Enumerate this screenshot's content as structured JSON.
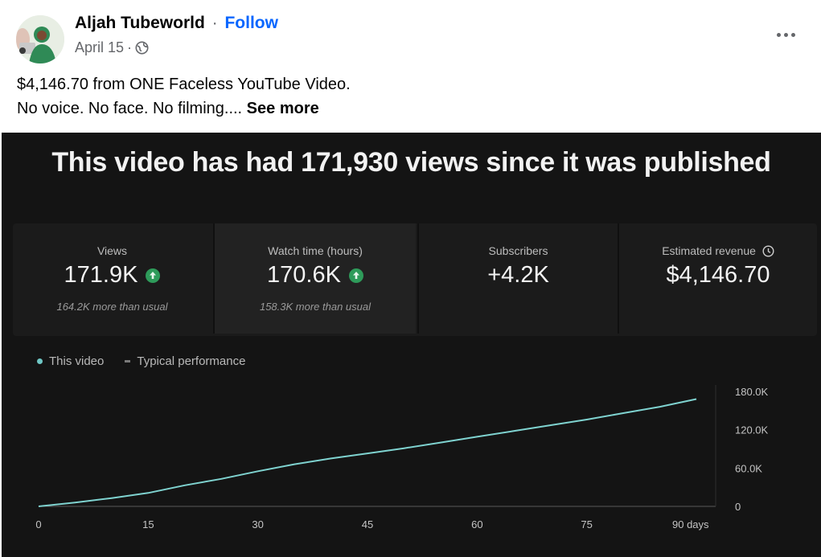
{
  "post": {
    "author": "Aljah Tubeworld",
    "separator": "·",
    "follow_label": "Follow",
    "date": "April 15",
    "date_separator": "·",
    "privacy_icon": "globe-icon",
    "more_icon": "more-horizontal-icon",
    "caption_line1": "$4,146.70 from ONE Faceless YouTube Video.",
    "caption_line2": "No voice. No face. No filming....",
    "see_more_label": "See more"
  },
  "image": {
    "headline": "This video has had 171,930 views since it was published",
    "stats": [
      {
        "label": "Views",
        "value": "171.9K",
        "up": true,
        "sub": "164.2K more than usual"
      },
      {
        "label": "Watch time (hours)",
        "value": "170.6K",
        "up": true,
        "sub": "158.3K more than usual"
      },
      {
        "label": "Subscribers",
        "value": "+4.2K",
        "up": false,
        "sub": ""
      },
      {
        "label": "Estimated revenue",
        "value": "$4,146.70",
        "up": false,
        "sub": ""
      }
    ],
    "legend": {
      "this_video": "This video",
      "typical": "Typical performance"
    },
    "colors": {
      "line": "#7fd3d0",
      "background": "#141414",
      "up_badge": "#2e9b5a"
    }
  },
  "chart_data": {
    "type": "line",
    "title": "",
    "xlabel": "",
    "ylabel": "",
    "x_ticks": [
      "0",
      "15",
      "30",
      "45",
      "60",
      "75",
      "90 days"
    ],
    "x_tick_values": [
      0,
      15,
      30,
      45,
      60,
      75,
      90
    ],
    "y_ticks": [
      "0",
      "60.0K",
      "120.0K",
      "180.0K"
    ],
    "y_tick_values": [
      0,
      60000,
      120000,
      180000
    ],
    "xlim": [
      0,
      90
    ],
    "ylim": [
      0,
      180000
    ],
    "series": [
      {
        "name": "This video",
        "x": [
          0,
          5,
          10,
          15,
          20,
          25,
          30,
          35,
          40,
          45,
          50,
          55,
          60,
          65,
          70,
          75,
          80,
          85,
          90
        ],
        "y": [
          0,
          6000,
          13000,
          21000,
          33000,
          43000,
          55000,
          66000,
          75000,
          83000,
          91000,
          100000,
          109000,
          118000,
          127000,
          136000,
          146000,
          156000,
          168000
        ]
      }
    ]
  }
}
